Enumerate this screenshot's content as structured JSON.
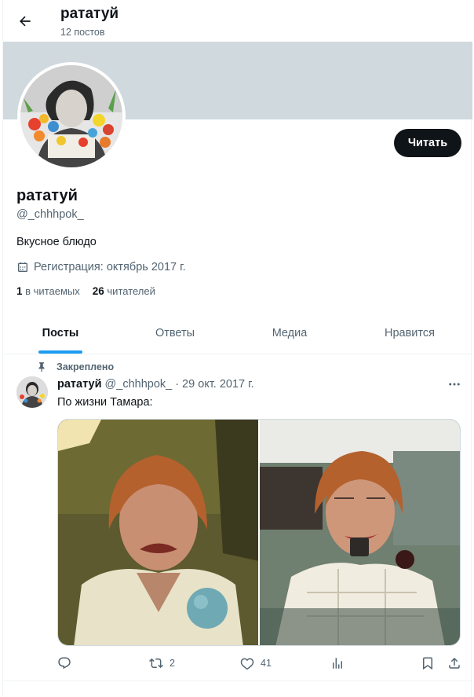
{
  "header": {
    "title": "рататуй",
    "posts_count": "12 постов"
  },
  "profile": {
    "name": "рататуй",
    "handle": "@_chhhpok_",
    "bio": "Вкусное блюдо",
    "joined": "Регистрация: октябрь 2017 г.",
    "following_count": "1",
    "following_label": "в читаемых",
    "followers_count": "26",
    "followers_label": "читателей",
    "follow_button": "Читать"
  },
  "tabs": [
    {
      "label": "Посты",
      "active": true
    },
    {
      "label": "Ответы",
      "active": false
    },
    {
      "label": "Медиа",
      "active": false
    },
    {
      "label": "Нравится",
      "active": false
    }
  ],
  "tweet": {
    "pinned_label": "Закреплено",
    "author_name": "рататуй",
    "author_handle": "@_chhhpok_",
    "separator": "·",
    "date": "29 окт. 2017 г.",
    "text": "По жизни Тамара:",
    "reply_count": "",
    "retweet_count": "2",
    "like_count": "41"
  },
  "colors": {
    "accent": "#1d9bf0",
    "banner": "#cfd9de",
    "text_primary": "#0f1419",
    "text_secondary": "#536471"
  },
  "icons": {
    "back": "arrow-left-icon",
    "calendar": "calendar-icon",
    "pin": "pin-icon",
    "more": "more-dots-icon",
    "reply": "reply-icon",
    "retweet": "retweet-icon",
    "like": "heart-icon",
    "views": "analytics-icon",
    "bookmark": "bookmark-icon",
    "share": "share-icon"
  }
}
